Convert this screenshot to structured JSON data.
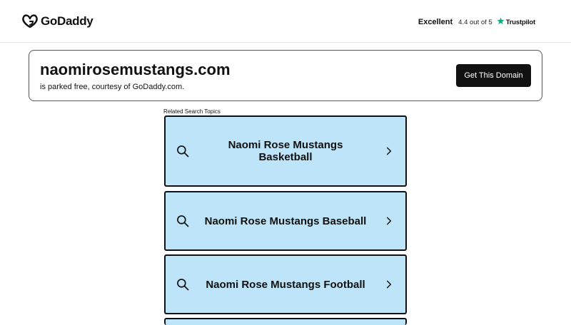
{
  "header": {
    "logo_text": "GoDaddy",
    "trust": {
      "rating_word": "Excellent",
      "score_text": "4.4 out of 5",
      "brand": "Trustpilot",
      "star_color": "#00b67a"
    }
  },
  "domain": {
    "name": "naomirosemustangs.com",
    "subtitle": "is parked free, courtesy of GoDaddy.com.",
    "cta_label": "Get This Domain"
  },
  "related": {
    "label": "Related Search Topics",
    "topics": [
      {
        "label": "Naomi Rose Mustangs Basketball"
      },
      {
        "label": "Naomi Rose Mustangs Baseball"
      },
      {
        "label": "Naomi Rose Mustangs Football"
      }
    ]
  },
  "colors": {
    "topic_bg": "#bde4f9",
    "cta_bg": "#111111"
  }
}
